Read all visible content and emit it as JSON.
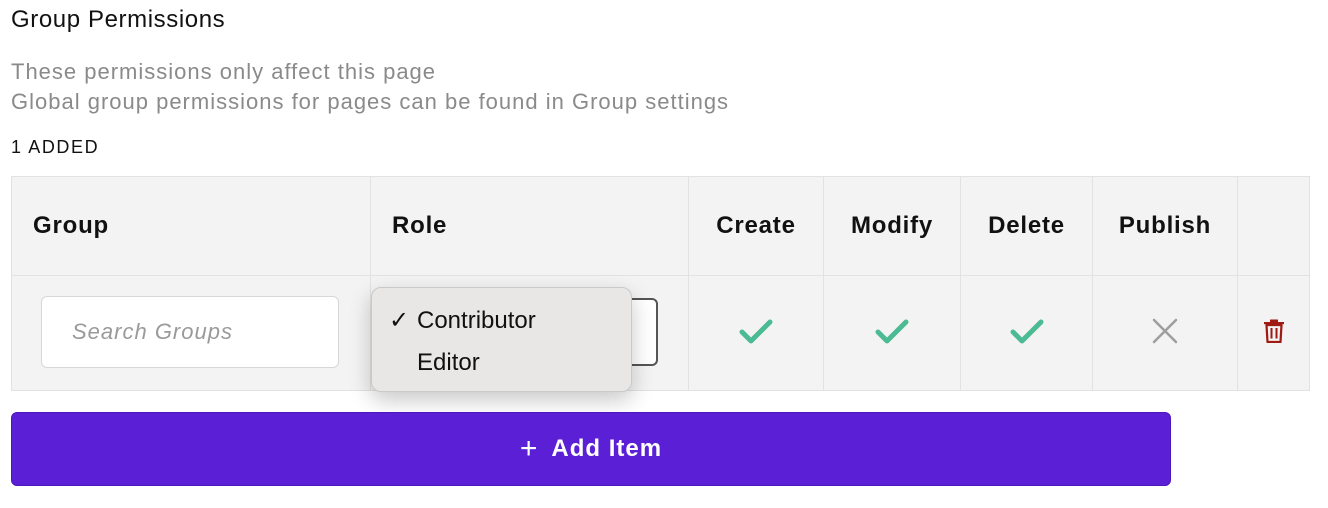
{
  "section": {
    "title": "Group Permissions",
    "description_line1": "These permissions only affect this page",
    "description_line2": "Global group permissions for pages can be found in Group settings",
    "added_count": "1 ADDED"
  },
  "table": {
    "headers": {
      "group": "Group",
      "role": "Role",
      "create": "Create",
      "modify": "Modify",
      "delete": "Delete",
      "publish": "Publish"
    },
    "row": {
      "search_placeholder": "Search Groups",
      "role_selected": "Contributor",
      "permissions": {
        "create": "check-icon",
        "modify": "check-icon",
        "delete": "check-icon",
        "publish": "x-icon"
      }
    }
  },
  "dropdown": {
    "options": [
      {
        "label": "Contributor",
        "selected": true
      },
      {
        "label": "Editor",
        "selected": false
      }
    ],
    "check_glyph": "✓"
  },
  "add_button": {
    "plus": "+",
    "label": "Add Item"
  },
  "colors": {
    "accent": "#5b1fd6",
    "check": "#4cbb94",
    "x_mark": "#9e9e9e",
    "delete": "#9e1a12"
  }
}
